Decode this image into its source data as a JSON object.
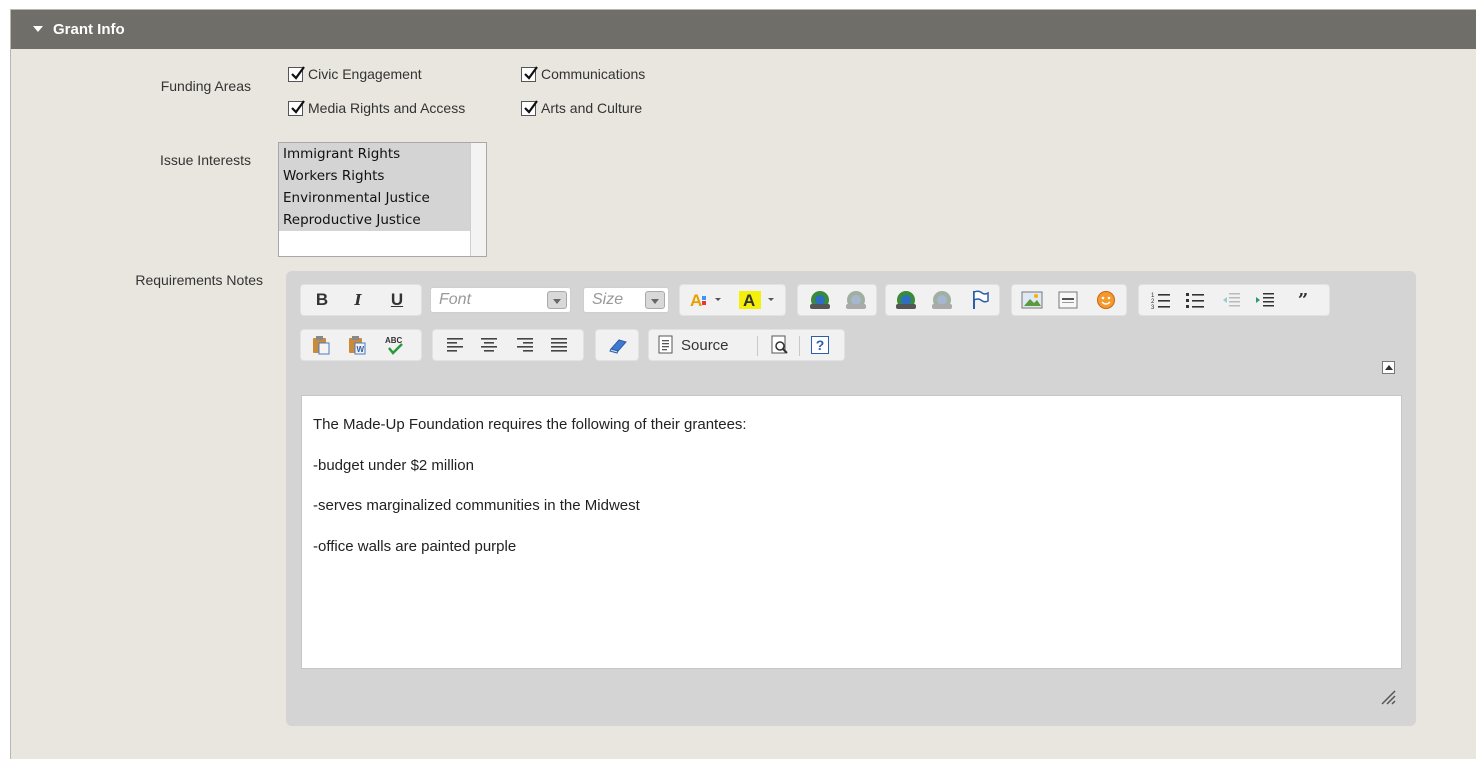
{
  "section": {
    "title": "Grant Info"
  },
  "funding": {
    "label": "Funding Areas",
    "options": [
      {
        "label": "Civic Engagement",
        "checked": true
      },
      {
        "label": "Communications",
        "checked": true
      },
      {
        "label": "Media Rights and Access",
        "checked": true
      },
      {
        "label": "Arts and Culture",
        "checked": true
      }
    ]
  },
  "issues": {
    "label": "Issue Interests",
    "options": [
      "Immigrant Rights",
      "Workers Rights",
      "Environmental Justice",
      "Reproductive Justice"
    ]
  },
  "requirements": {
    "label": "Requirements Notes",
    "toolbar": {
      "bold": "B",
      "italic": "I",
      "underline": "U",
      "font_placeholder": "Font",
      "size_placeholder": "Size",
      "source_label": "Source",
      "help": "?"
    },
    "paragraphs": [
      "The Made-Up Foundation requires the following of their grantees:",
      "-budget under $2 million",
      "-serves marginalized communities in the Midwest",
      "-office walls are painted purple"
    ]
  }
}
